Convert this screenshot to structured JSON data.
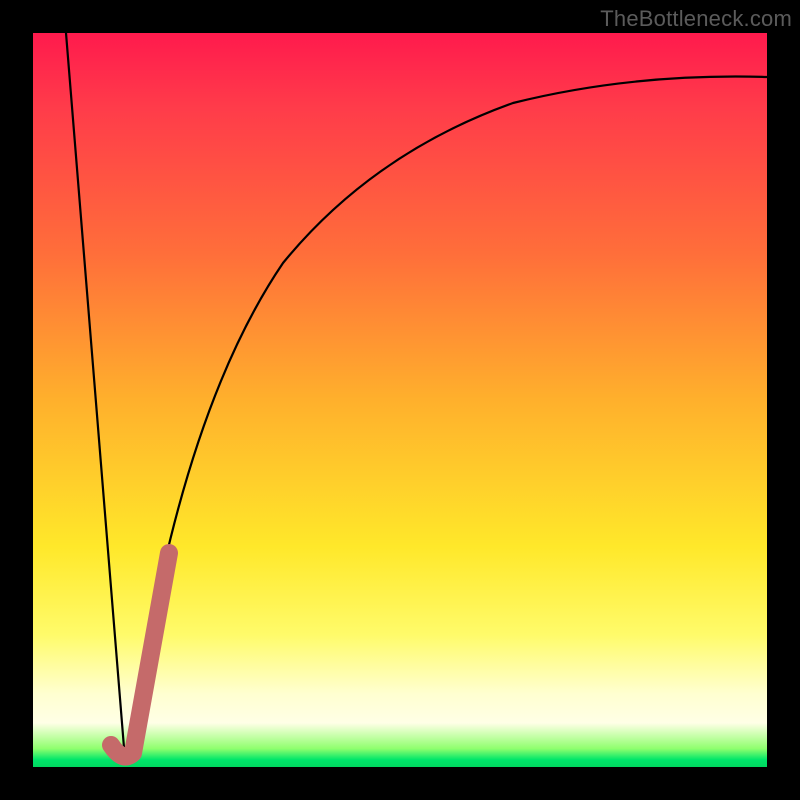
{
  "watermark": "TheBottleneck.com",
  "colors": {
    "frame": "#000000",
    "curve_thin": "#000000",
    "highlight": "#c56a6a",
    "gradient_stops": [
      "#ff1a4d",
      "#ff6e3a",
      "#ffe82a",
      "#ffffe6",
      "#00d860"
    ]
  },
  "chart_data": {
    "type": "line",
    "title": "",
    "xlabel": "",
    "ylabel": "",
    "xlim": [
      0,
      100
    ],
    "ylim": [
      0,
      100
    ],
    "series": [
      {
        "name": "v-left",
        "x": [
          4.5,
          12.5
        ],
        "y": [
          100,
          1
        ]
      },
      {
        "name": "saturating-right",
        "x": [
          12.5,
          15,
          18,
          22,
          26,
          30,
          35,
          40,
          48,
          58,
          70,
          85,
          100
        ],
        "y": [
          1,
          12,
          26,
          40,
          52,
          61,
          69,
          75,
          81,
          86,
          90,
          92.5,
          94
        ]
      },
      {
        "name": "highlight-segment",
        "x": [
          10.5,
          13.5,
          18.5
        ],
        "y": [
          3,
          2,
          29
        ]
      }
    ]
  }
}
